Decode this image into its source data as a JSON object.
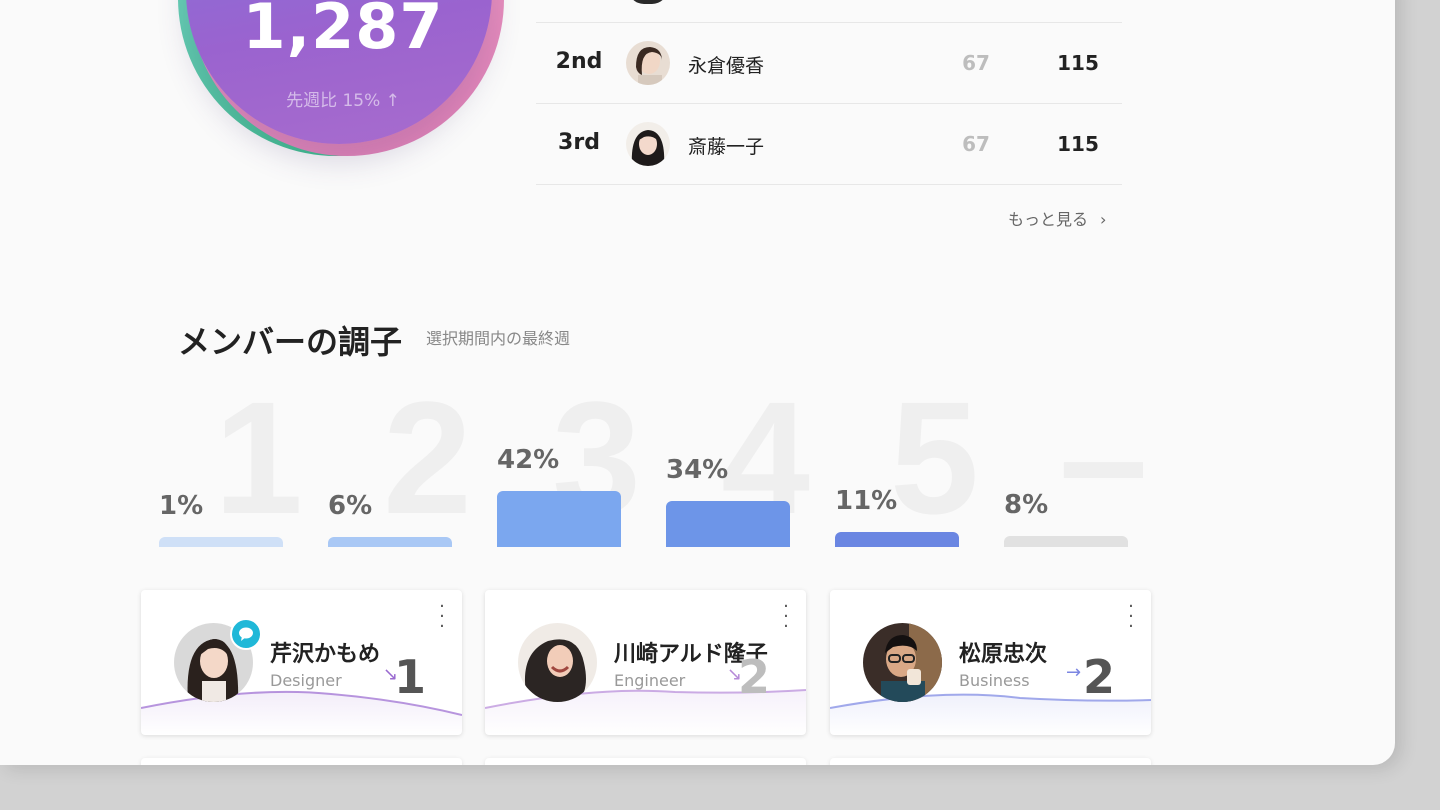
{
  "score": {
    "value": "1,287",
    "change_label": "先週比 15% ↑"
  },
  "ranking": {
    "rows": [
      {
        "rank": "2nd",
        "name": "永倉優香",
        "count_a": "67",
        "count_b": "115"
      },
      {
        "rank": "3rd",
        "name": "斎藤一子",
        "count_a": "67",
        "count_b": "115"
      }
    ],
    "more_label": "もっと見る",
    "more_icon": "chevron-right-icon"
  },
  "section": {
    "title": "メンバーの調子",
    "subtitle": "選択期間内の最終週"
  },
  "chart_data": {
    "type": "bar",
    "categories": [
      "1",
      "2",
      "3",
      "4",
      "5",
      "–"
    ],
    "values": [
      1,
      6,
      42,
      34,
      11,
      8
    ],
    "labels": [
      "1%",
      "6%",
      "42%",
      "34%",
      "11%",
      "8%"
    ],
    "colors": [
      "#cfe0f7",
      "#a9c8f5",
      "#7ba7ef",
      "#6d95e8",
      "#6a86e2",
      "#e1e1e1"
    ],
    "ylim": [
      0,
      100
    ]
  },
  "members": [
    {
      "name": "芹沢かもめ",
      "role": "Designer",
      "trend_value": "1",
      "trend_dir": "down",
      "trend_color": "#9a6ad0",
      "num_color": "#555555",
      "has_message": true
    },
    {
      "name": "川崎アルド隆子",
      "role": "Engineer",
      "trend_value": "2",
      "trend_dir": "down",
      "trend_color": "#b68ad8",
      "num_color": "#bdbdbd",
      "has_message": false
    },
    {
      "name": "松原忠次",
      "role": "Business",
      "trend_value": "2",
      "trend_dir": "flat",
      "trend_color": "#7b86e2",
      "num_color": "#555555",
      "has_message": false
    }
  ],
  "colors": {
    "accent_purple": "#9a63cf",
    "message_badge": "#20b8d8"
  }
}
